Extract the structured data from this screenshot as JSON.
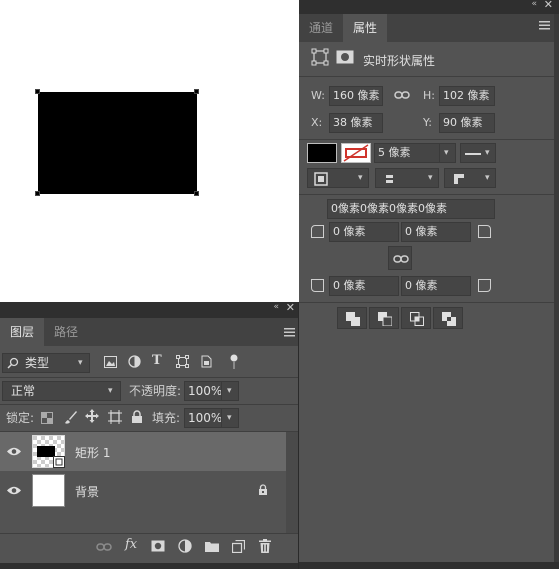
{
  "properties_panel": {
    "tabs": [
      "通道",
      "属性"
    ],
    "title": "实时形状属性",
    "w_label": "W:",
    "w_value": "160 像素",
    "h_label": "H:",
    "h_value": "102 像素",
    "x_label": "X:",
    "x_value": "38 像素",
    "y_label": "Y:",
    "y_value": "90 像素",
    "stroke_width": "5 像素",
    "corners_all": "0像素0像素0像素0像素",
    "corner_tl": "0 像素",
    "corner_tr": "0 像素",
    "corner_bl": "0 像素",
    "corner_br": "0 像素"
  },
  "layers_panel": {
    "tabs": [
      "图层",
      "路径"
    ],
    "filter_kind": "类型",
    "blend_mode": "正常",
    "opacity_label": "不透明度:",
    "opacity_value": "100%",
    "lock_label": "锁定:",
    "fill_label": "填充:",
    "fill_value": "100%",
    "layers": [
      {
        "name": "矩形 1"
      },
      {
        "name": "背景"
      }
    ],
    "fx_label": "fx"
  },
  "colors": {
    "accent_fill": "#000000",
    "stroke_red": "#d0342c"
  }
}
